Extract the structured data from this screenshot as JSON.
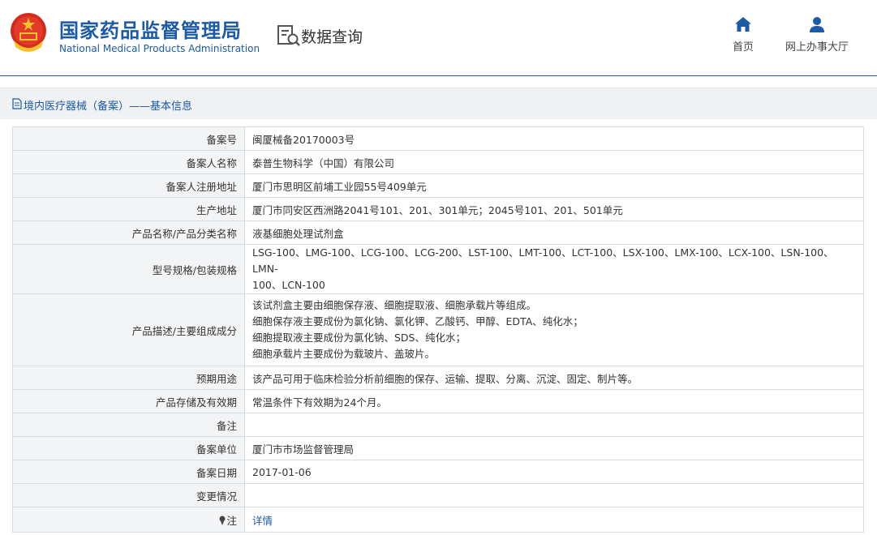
{
  "header": {
    "org_name_cn": "国家药品监督管理局",
    "org_name_en": "National Medical Products Administration",
    "query_label": "数据查询",
    "nav": [
      {
        "label": "首页",
        "icon": "home-icon"
      },
      {
        "label": "网上办事大厅",
        "icon": "user-icon"
      }
    ]
  },
  "subbar": {
    "text": "境内医疗器械（备案）——基本信息"
  },
  "colors": {
    "brand": "#1c5aa6",
    "label_bg": "#f3f4f6",
    "border": "#d9dde2"
  },
  "rows": [
    {
      "label": "备案号",
      "value": "闽厦械备20170003号"
    },
    {
      "label": "备案人名称",
      "value": "泰普生物科学（中国）有限公司"
    },
    {
      "label": "备案人注册地址",
      "value": "厦门市思明区前埔工业园55号409单元"
    },
    {
      "label": "生产地址",
      "value": "厦门市同安区西洲路2041号101、201、301单元；2045号101、201、501单元"
    },
    {
      "label": "产品名称/产品分类名称",
      "value": "液基细胞处理试剂盒"
    },
    {
      "label": "型号规格/包装规格",
      "lines": [
        "LSG-100、LMG-100、LCG-100、LCG-200、LST-100、LMT-100、LCT-100、LSX-100、LMX-100、LCX-100、LSN-100、LMN-",
        "100、LCN-100"
      ]
    },
    {
      "label": "产品描述/主要组成成分",
      "lines": [
        "该试剂盒主要由细胞保存液、细胞提取液、细胞承载片等组成。",
        "细胞保存液主要成份为氯化钠、氯化钾、乙酸钙、甲醇、EDTA、纯化水；",
        "细胞提取液主要成份为氯化钠、SDS、纯化水；",
        "细胞承载片主要成份为载玻片、盖玻片。"
      ]
    },
    {
      "label": "预期用途",
      "value": "该产品可用于临床检验分析前细胞的保存、运输、提取、分离、沉淀、固定、制片等。"
    },
    {
      "label": "产品存储及有效期",
      "value": "常温条件下有效期为24个月。"
    },
    {
      "label": "备注",
      "value": ""
    },
    {
      "label": "备案单位",
      "value": "厦门市市场监督管理局"
    },
    {
      "label": "备案日期",
      "value": "2017-01-06"
    },
    {
      "label": "变更情况",
      "value": ""
    },
    {
      "label": "注",
      "value": "详情",
      "icon": "pin-icon"
    }
  ]
}
